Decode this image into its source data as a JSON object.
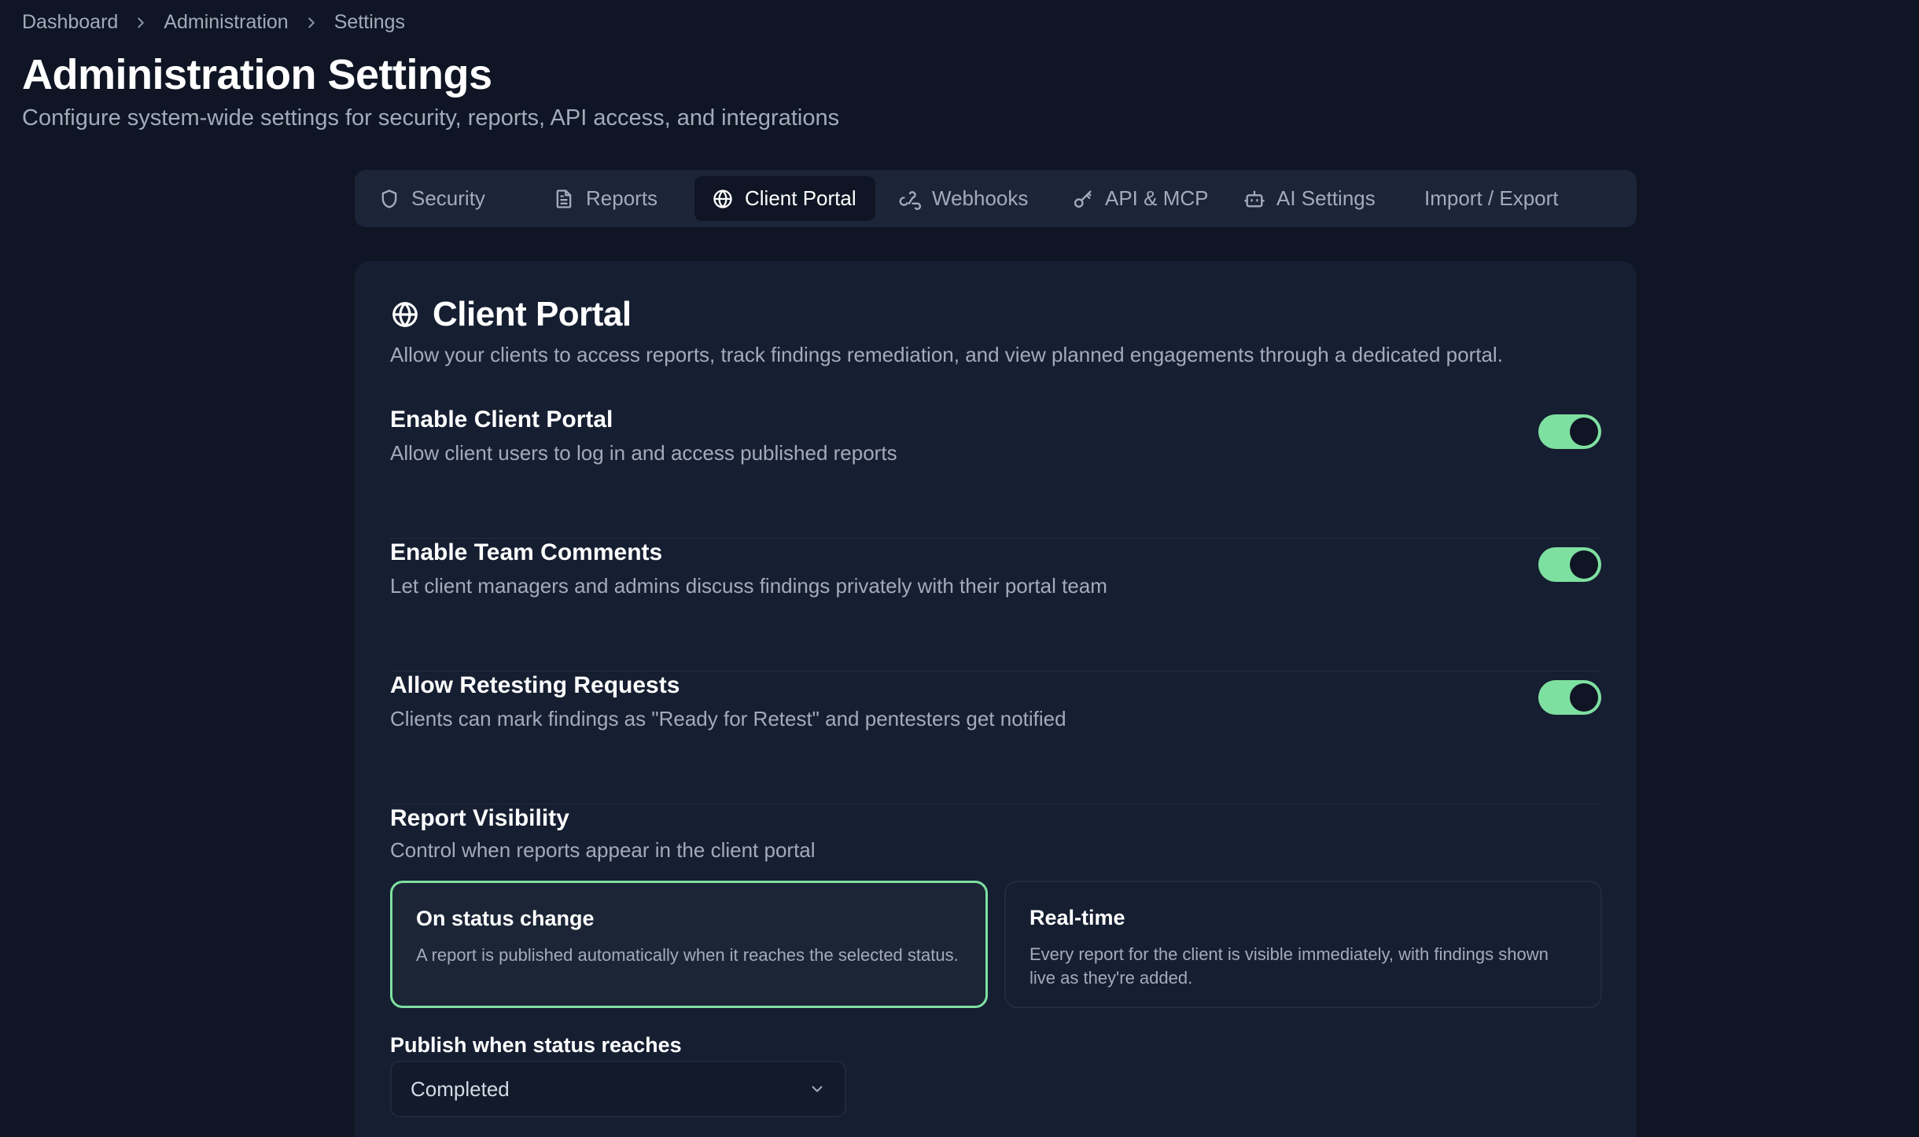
{
  "breadcrumb": {
    "items": [
      "Dashboard",
      "Administration",
      "Settings"
    ]
  },
  "header": {
    "title": "Administration Settings",
    "subtitle": "Configure system-wide settings for security, reports, API access, and integrations"
  },
  "tabs": [
    {
      "label": "Security",
      "icon": "shield-icon"
    },
    {
      "label": "Reports",
      "icon": "document-icon"
    },
    {
      "label": "Client Portal",
      "icon": "globe-icon",
      "active": true
    },
    {
      "label": "Webhooks",
      "icon": "webhook-icon"
    },
    {
      "label": "API & MCP",
      "icon": "key-icon"
    },
    {
      "label": "AI Settings",
      "icon": "bot-icon"
    },
    {
      "label": "Import / Export"
    }
  ],
  "card": {
    "title": "Client Portal",
    "description": "Allow your clients to access reports, track findings remediation, and view planned engagements through a dedicated portal.",
    "settings": [
      {
        "label": "Enable Client Portal",
        "help": "Allow client users to log in and access published reports",
        "enabled": true
      },
      {
        "label": "Enable Team Comments",
        "help": "Let client managers and admins discuss findings privately with their portal team",
        "enabled": true
      },
      {
        "label": "Allow Retesting Requests",
        "help": "Clients can mark findings as \"Ready for Retest\" and pentesters get notified",
        "enabled": true
      }
    ],
    "visibility": {
      "label": "Report Visibility",
      "help": "Control when reports appear in the client portal",
      "options": [
        {
          "title": "On status change",
          "description": "A report is published automatically when it reaches the selected status.",
          "selected": true
        },
        {
          "title": "Real-time",
          "description": "Every report for the client is visible immediately, with findings shown live as they're added.",
          "selected": false
        }
      ]
    },
    "publish": {
      "label": "Publish when status reaches",
      "value": "Completed"
    }
  },
  "colors": {
    "background": "#0f1524",
    "card": "#161e31",
    "accent": "#7ee0a0",
    "muted": "#a3abbb"
  }
}
